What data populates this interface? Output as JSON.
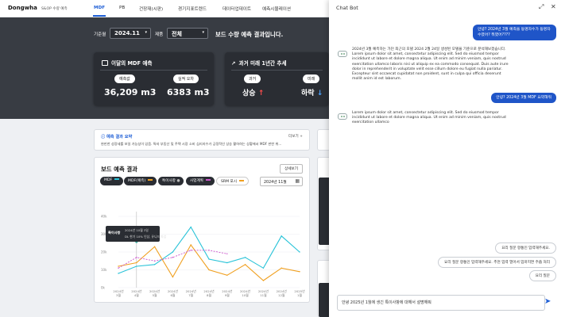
{
  "nav": {
    "logo": "Dongwha",
    "logo_sub": "S&OP 수량 예측",
    "items": [
      "MDF",
      "PB",
      "건장재(시판)",
      "경기지표트렌드",
      "데이터업데이트",
      "예측시뮬레이션"
    ]
  },
  "filters": {
    "period_label": "기준월",
    "period_value": "2024.11",
    "product_label": "제품",
    "product_value": "전체",
    "caption": "보드 수량 예측 결과입니다."
  },
  "mdf_card": {
    "title": "이달의 MDF 예측",
    "forecast_label": "예측값",
    "forecast_value": "36,209 m3",
    "error_label": "실적 오차",
    "error_value": "6383 m3"
  },
  "trend_card": {
    "title": "과거 미래 1년간 추세",
    "past_label": "과거",
    "past_value": "상승",
    "future_label": "미래",
    "future_value": "하락"
  },
  "summary": {
    "title": "예측 결과 요약",
    "more": "더보기 +",
    "text": "완만한 성장세를 보일 가능성이 있음. 특자 부동산 및 주택 시장 소비 심리지수가 긍정적인 상승 활하하는 상황에서 MDF 판한 위..."
  },
  "chart": {
    "title": "보드 예측 결과",
    "detail_button": "상세보기",
    "date_value": "2024년 11월",
    "legend": [
      {
        "label": "MDF",
        "color": "#29c3d8"
      },
      {
        "label": "MDF(예측)",
        "color": "#f0a020"
      },
      {
        "label": "특이사항",
        "color": "#999999"
      },
      {
        "label": "사업계획",
        "color": "#cc55cc"
      },
      {
        "label": "SRM 포시",
        "color": "#f0a020"
      }
    ],
    "tooltip_tag": "특이사항",
    "tooltip_line1": "2024년 10월 3일",
    "tooltip_line2": "DL 한기 10% 인상, 유니드 파업"
  },
  "chart_data": {
    "type": "line",
    "categories": [
      "2024년 3월",
      "2024년 4월",
      "2024년 5월",
      "2024년 6월",
      "2024년 7월",
      "2024년 8월",
      "2024년 9월",
      "2024년 10월",
      "2024년 11월",
      "2024년 12월",
      "2025년 1월"
    ],
    "tick_labels": [
      [
        "2024년",
        "3월"
      ],
      [
        "2024년",
        "4월"
      ],
      [
        "2024년",
        "5월"
      ],
      [
        "2024년",
        "6월"
      ],
      [
        "2024년",
        "7월"
      ],
      [
        "2024년",
        "8월"
      ],
      [
        "2024년",
        "9월"
      ],
      [
        "2024년",
        "10월"
      ],
      [
        "2024년",
        "11월"
      ],
      [
        "2024년",
        "12월"
      ],
      [
        "2025년",
        "1월"
      ]
    ],
    "y_ticks": [
      "0k",
      "10k",
      "20k",
      "30k",
      "40k"
    ],
    "ylim": [
      0,
      40
    ],
    "series": [
      {
        "name": "MDF",
        "color": "#29c3d8",
        "dash": false,
        "values": [
          8,
          12,
          13,
          20,
          34,
          16,
          14,
          17,
          11,
          29,
          20
        ]
      },
      {
        "name": "MDF(예측)",
        "color": "#f0a020",
        "dash": false,
        "values": [
          12,
          14,
          23,
          6,
          24,
          10,
          7,
          13,
          4,
          11,
          9
        ]
      },
      {
        "name": "사업계획",
        "color": "#cc55cc",
        "dash": true,
        "values": [
          11,
          17,
          15,
          17,
          21,
          21,
          19,
          null,
          null,
          null,
          null
        ]
      }
    ],
    "marker_index": 1
  },
  "strip": {
    "label1": "동향",
    "label2": "연립"
  },
  "chat": {
    "title": "Chat Bot",
    "expand_icon": "⤢",
    "close_icon": "✕",
    "user_msg_1": "안녕? 2024년 3월 예측을 동명자수가 동명자수였어? 뭐였어????",
    "bot_msg_1": "2024년 3월 예측하는 가던 최근의 모델 2024 2월 24일 생성된 모델을 기준으로 분석해보겠습니다. Lorem ipsum dolor sit amet, consectetur adipiscing elit. Sed do eiusmod tempor incididunt ut labore et dolore magna aliqua. Ut enim ad minim veniam, quis nostrud exercitation ullamco laboris nisi ut aliquip ex ea commodo consequat. Duis aute irure dolor in reprehenderit in voluptate velit esse cillum dolore eu fugiat nulla pariatur. Excepteur sint occaecat cupidatat non proident, sunt in culpa qui officia deserunt mollit anim id est laborum.",
    "user_msg_2": "안녕? 2024년 3월 MDF 요약해줘",
    "bot_msg_2": "Lorem ipsum dolor sit amet, consectetur adipiscing elit. Sed do eiusmod tempor incididunt ut labore et dolore magna aliqua. Ut enim ad minim veniam, quis nostrud exercitation ullamco",
    "suggestions": [
      "요리 질문 항통인 입력해주세요.",
      "요리 질문 항통인 입력해주세요. 추천 입력 열어서 입마지면 주줍 처리",
      "요리 질문"
    ],
    "input_value": "안녕 2025년 1월에 생긴 특이사항에 대해서 설명해줘",
    "send_icon": "➤"
  }
}
